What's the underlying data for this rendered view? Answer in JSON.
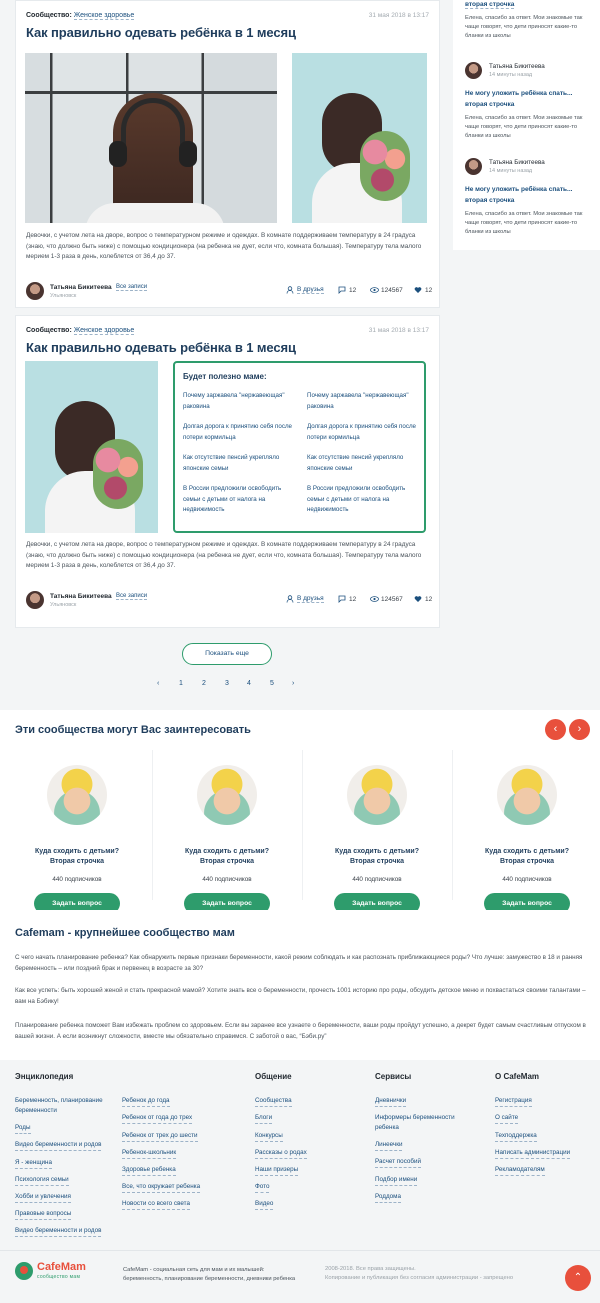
{
  "post1": {
    "category_label": "Сообщество:",
    "category": "Женское здоровье",
    "date": "31 мая 2018 в 13:17",
    "title": "Как правильно одевать ребёнка в 1 месяц",
    "text": "Девочки, с учетом лета на дворе, вопрос о температурном режиме и одеждах. В комнате поддерживаем температуру в 24 градуса (знаю, что должно быть ниже) с помощью кондиционера (на ребенка не дует, если что, комната большая). Температуру тела малого мерием 1-3 раза в день, колеблется от 36,4 до 37.",
    "author": "Татьяна Бикитеева",
    "city": "Ульяновск",
    "all_posts": "Все записи",
    "friends": "В друзья",
    "comments": "12",
    "views": "124567",
    "likes": "12"
  },
  "post2": {
    "category_label": "Сообщество:",
    "category": "Женское здоровье",
    "date": "31 мая 2018 в 13:17",
    "title": "Как правильно одевать ребёнка в 1 месяц",
    "text": "Девочки, с учетом лета на дворе, вопрос о температурном режиме и одеждах. В комнате поддерживаем температуру в 24 градуса (знаю, что должно быть ниже) с помощью кондиционера (на ребенка не дует, если что, комната большая). Температуру тела малого мерием 1-3 раза в день, колеблется от 36,4 до 37.",
    "author": "Татьяна Бикитеева",
    "city": "Ульяновск",
    "all_posts": "Все записи",
    "friends": "В друзья",
    "comments": "12",
    "views": "124567",
    "likes": "12",
    "useful": {
      "heading": "Будет полезно маме:",
      "left": [
        "Почему заржавела \"нержавеющая\" раковина",
        "Долгая дорога к принятию себя после потери кормильца",
        "Как отсутствие пенсий укрепляло японские семьи",
        "В России предложили освободить семьи с детьми от налога на недвижимость"
      ],
      "right": [
        "Почему заржавела \"нержавеющая\" раковина",
        "Долгая дорога к принятию себя после потери кормильца",
        "Как отсутствие пенсий укрепляло японские семьи",
        "В России предложили освободить семьи с детьми от налога на недвижимость"
      ]
    }
  },
  "sidebar": {
    "top_question": "вторая строчка",
    "top_answer": "Елена, спасибо за ответ. Мои знакомые так чаще говорят, что дети приносят какие-то бланки из школы",
    "items": [
      {
        "name": "Татьяна Бикитеева",
        "time": "14 минуты назад",
        "question": "Не могу уложить ребёнка спать... вторая строчка",
        "answer": "Елена, спасибо за ответ. Мои знакомые так чаще говорят, что дети приносят какие-то бланки из школы"
      },
      {
        "name": "Татьяна Бикитеева",
        "time": "14 минуты назад",
        "question": "Не могу уложить ребёнка спать... вторая строчка",
        "answer": "Елена, спасибо за ответ. Мои знакомые так чаще говорят, что дети приносят какие-то бланки из школы"
      }
    ]
  },
  "show_more": "Показать еще",
  "pager": [
    "‹",
    "1",
    "2",
    "3",
    "4",
    "5",
    "›"
  ],
  "communities": {
    "heading": "Эти сообщества могут Вас заинтересовать",
    "items": [
      {
        "title": "Куда сходить с детьми?",
        "subtitle": "Вторая строчка",
        "subs": "440 подписчиков",
        "btn": "Задать вопрос"
      },
      {
        "title": "Куда сходить с детьми?",
        "subtitle": "Вторая строчка",
        "subs": "440 подписчиков",
        "btn": "Задать вопрос"
      },
      {
        "title": "Куда сходить с детьми?",
        "subtitle": "Вторая строчка",
        "subs": "440 подписчиков",
        "btn": "Задать вопрос"
      },
      {
        "title": "Куда сходить с детьми?",
        "subtitle": "Вторая строчка",
        "subs": "440 подписчиков",
        "btn": "Задать вопрос"
      }
    ]
  },
  "about": {
    "heading": "Cafemam -  крупнейшее сообщество мам",
    "p1": "С чего начать планирование ребенка? Как обнаружить первые признаки беременности, какой режим соблюдать и как распознать приближающиеся роды? Что лучше: замужество в 18 и ранняя беременность – или поздний брак и первенец в возрасте за 30?",
    "p2": "Как все успеть: быть хорошей женой и стать прекрасной мамой? Хотите знать все о беременности, прочесть 1001 историю про роды, обсудить детское меню и похвастаться своими талантами – вам на Бэбику!",
    "p3": "Планирование ребенка поможет Вам избежать проблем со здоровьем. Если вы заранее все узнаете о беременности, ваши роды пройдут успешно, а декрет будет самым счастливым отпуском в вашей жизни. А если возникнут сложности, вместе мы обязательно справимся. С заботой о вас, “Бэби.ру”"
  },
  "footer": {
    "col1": {
      "heading": "Энциклопедия",
      "links": [
        "Беременность, планирование беременности",
        "Роды",
        "Видео беременности и родов",
        "Я - женщина",
        "Психология семьи",
        "Хобби и увлечения",
        "Правовые вопросы",
        "Видео беременности и родов"
      ]
    },
    "col2": {
      "links": [
        "Ребенок до года",
        "Ребенок от года до трех",
        "Ребенок от трех до шести",
        "Ребенок-школьник",
        "Здоровье ребенка",
        "Все, что окружает ребенка",
        "Новости со всего света"
      ]
    },
    "col3": {
      "heading": "Общение",
      "links": [
        "Сообщества",
        "Блоги",
        "Конкурсы",
        "Рассказы о родах",
        "Наши призеры",
        "Фото",
        "Видео"
      ]
    },
    "col4": {
      "heading": "Сервисы",
      "links": [
        "Дневнички",
        "Информеры беременности ребенка",
        "Линеечки",
        "Расчет пособий",
        "Подбор имени",
        "Роддома"
      ]
    },
    "col5": {
      "heading": "О CafeMam",
      "links": [
        "Регистрация",
        "О сайте",
        "Техподдержка",
        "Написать администрации",
        "Рекламодателям"
      ]
    },
    "logo_name": "CafeMam",
    "logo_sub": "сообщество мам",
    "desc": "CafeMam - социальная сеть для мам и их малышей: беременность, планирование беременности, дневники ребенка",
    "copy1": "2008-2018. Все права защищены.",
    "copy2": "Копирование и публикация без согласия администрации - запрещено"
  },
  "colors": {
    "accent": "#2e9c6c",
    "link": "#1b4f7d",
    "red": "#e8503c"
  }
}
